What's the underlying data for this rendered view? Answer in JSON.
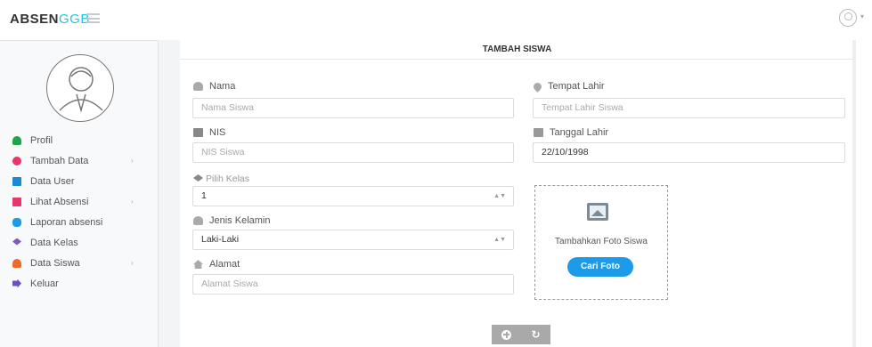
{
  "brand": {
    "part1": "ABSEN",
    "part2": "GGB"
  },
  "sidebar": {
    "items": [
      {
        "label": "Profil",
        "color": "#1fa44a",
        "arrow": ""
      },
      {
        "label": "Tambah Data",
        "color": "#e8356a",
        "arrow": "›"
      },
      {
        "label": "Data User",
        "color": "#1e88d8",
        "arrow": ""
      },
      {
        "label": "Lihat Absensi",
        "color": "#e8356a",
        "arrow": "›"
      },
      {
        "label": "Laporan absensi",
        "color": "#1e9be8",
        "arrow": ""
      },
      {
        "label": "Data Kelas",
        "color": "#7e57c2",
        "arrow": ""
      },
      {
        "label": "Data Siswa",
        "color": "#ee6a2b",
        "arrow": "›"
      },
      {
        "label": "Keluar",
        "color": "#6a4fc7",
        "arrow": ""
      }
    ]
  },
  "panel": {
    "title": "TAMBAH SISWA"
  },
  "form": {
    "nama": {
      "label": "Nama",
      "placeholder": "Nama Siswa"
    },
    "nis": {
      "label": "NIS",
      "placeholder": "NIS Siswa"
    },
    "kelas": {
      "label": "Pilih Kelas",
      "value": "1"
    },
    "jenis_kelamin": {
      "label": "Jenis Kelamin",
      "value": "Laki-Laki"
    },
    "alamat": {
      "label": "Alamat",
      "placeholder": "Alamat Siswa"
    },
    "tempat_lahir": {
      "label": "Tempat Lahir",
      "placeholder": "Tempat Lahir Siswa"
    },
    "tanggal_lahir": {
      "label": "Tanggal Lahir",
      "value": "22/10/1998"
    }
  },
  "photo": {
    "label": "Tambahkan Foto Siswa",
    "button": "Cari Foto"
  },
  "colors": {
    "accent": "#1e9be8",
    "brand_accent": "#22c3e6"
  }
}
